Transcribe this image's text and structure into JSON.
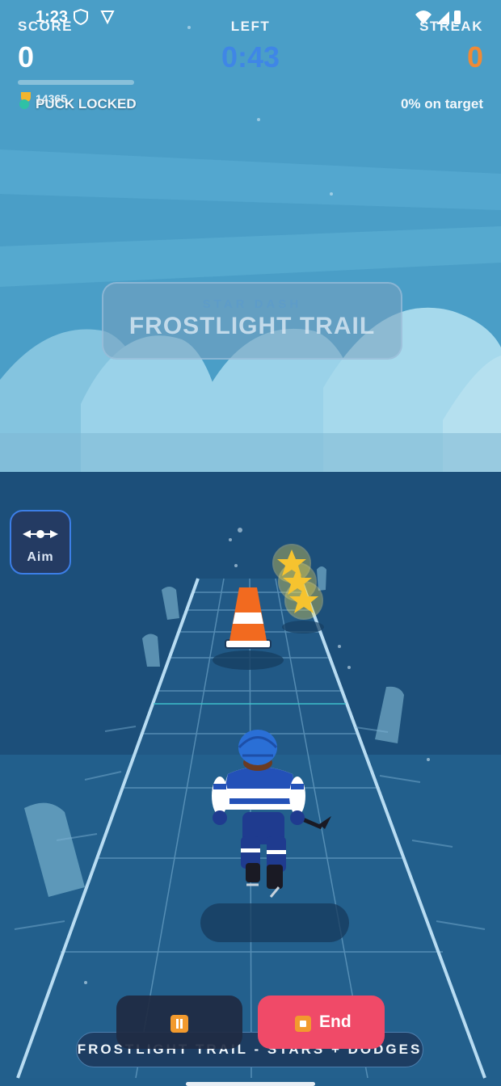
{
  "status_bar": {
    "time": "1:23"
  },
  "hud": {
    "score_label": "SCORE",
    "score_value": "0",
    "left_label": "LEFT",
    "time_left": "0:43",
    "streak_label": "STREAK",
    "streak_value": "0",
    "best_score": "14365",
    "puck_status": "PUCK LOCKED",
    "accuracy": "0% on target",
    "progress": 0
  },
  "title_card": {
    "subtitle": "STAR DASH",
    "title": "FROSTLIGHT TRAIL"
  },
  "aim_button": {
    "label": "Aim",
    "icon": "aim-arrows-icon"
  },
  "controls": {
    "pause_icon": "pause-icon",
    "end_label": "End",
    "end_icon": "stop-icon"
  },
  "banner": {
    "text": "FROSTLIGHT TRAIL - STARS + DODGES"
  },
  "colors": {
    "sky": "#4a9ec7",
    "ice": "#1e5a86",
    "accent_blue": "#3f86e6",
    "streak_orange": "#f08a36",
    "end_red": "#f04a68"
  }
}
